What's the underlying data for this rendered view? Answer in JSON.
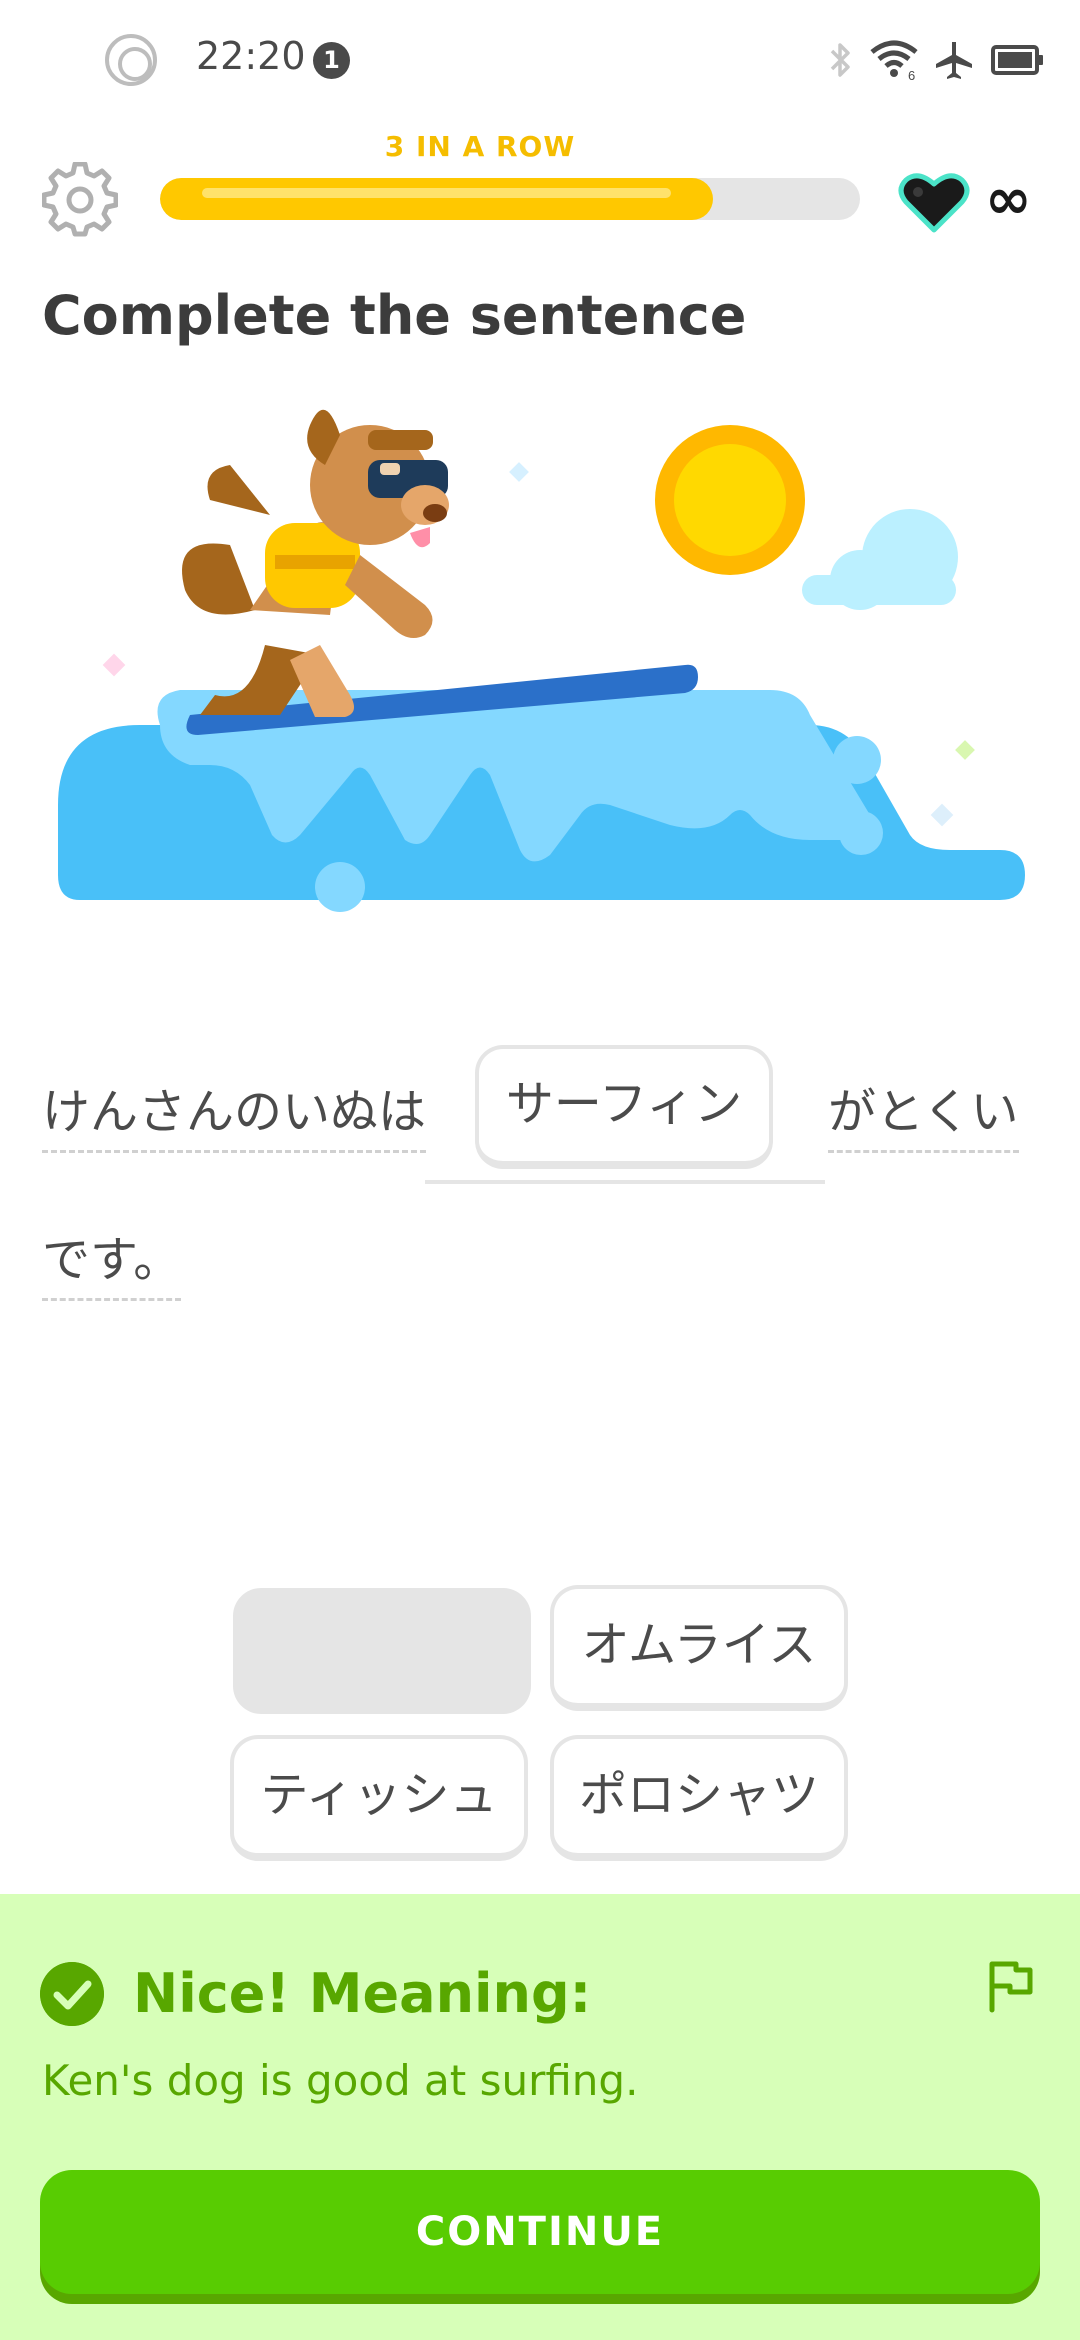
{
  "status_bar": {
    "time": "22:20",
    "notification_count": "1",
    "wifi_badge": "6",
    "icons": [
      "record-icon",
      "bluetooth-icon",
      "wifi-icon",
      "airplane-icon",
      "battery-icon"
    ]
  },
  "header": {
    "streak_label": "3 IN A ROW",
    "progress": 0.79,
    "hearts": "∞",
    "progress_color": "#ffc800",
    "streak_color": "#f5bd00"
  },
  "exercise": {
    "title": "Complete the sentence",
    "sentence_before": "けんさんのいぬは",
    "answer": "サーフィン",
    "sentence_after_1": "がとくい",
    "sentence_after_2": "です。"
  },
  "word_bank": [
    {
      "label": "",
      "used": true
    },
    {
      "label": "オムライス",
      "used": false
    },
    {
      "label": "ティッシュ",
      "used": false
    },
    {
      "label": "ポロシャツ",
      "used": false
    }
  ],
  "feedback": {
    "heading": "Nice! Meaning:",
    "meaning": "Ken's dog is good at surfing.",
    "continue_label": "CONTINUE",
    "background_color": "#d7ffb8",
    "accent_color": "#58a700",
    "button_color": "#58cc02"
  }
}
